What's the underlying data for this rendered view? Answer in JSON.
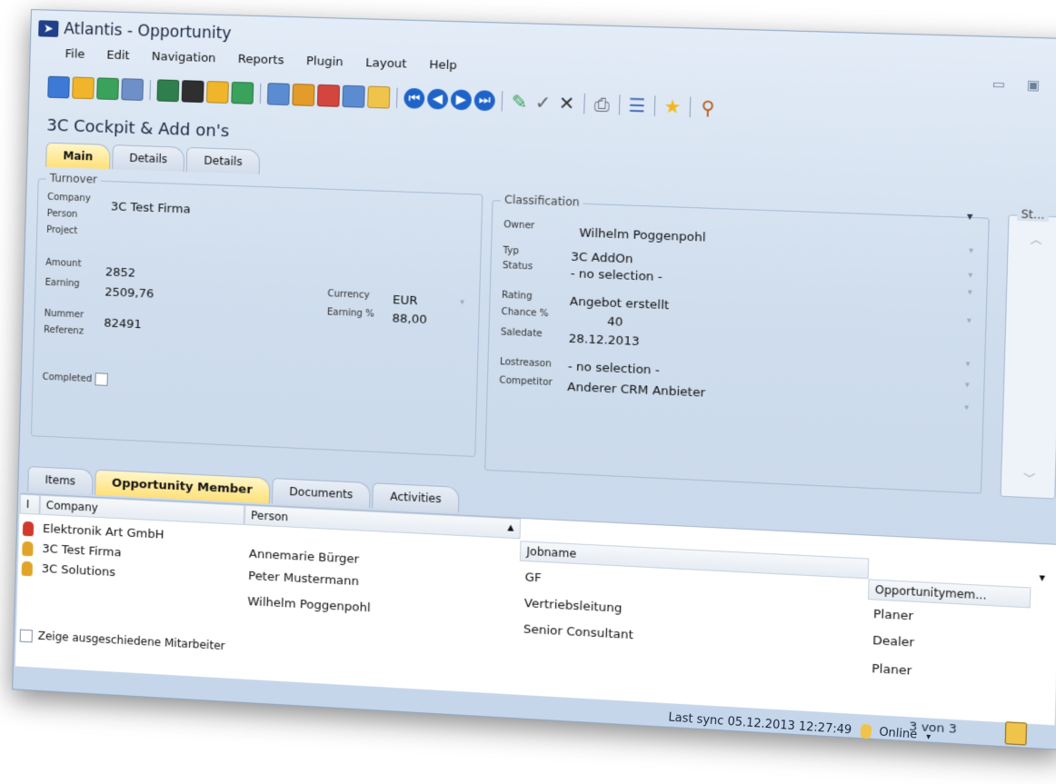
{
  "window": {
    "title": "Atlantis - Opportunity",
    "record_title": "3C Cockpit & Add on's",
    "controls": [
      "▭",
      "▣",
      "✕"
    ]
  },
  "menu": [
    "File",
    "Edit",
    "Navigation",
    "Reports",
    "Plugin",
    "Layout",
    "Help"
  ],
  "toolbar": {
    "groups": [
      [
        {
          "icon": "building-icon",
          "color": "#3d7ad6"
        },
        {
          "icon": "open-folder-icon",
          "color": "#f0b52a"
        },
        {
          "icon": "money-icon",
          "color": "#3aa25a"
        },
        {
          "icon": "calendar-icon",
          "color": "#6e8fc8"
        }
      ],
      [
        {
          "icon": "new-company-icon",
          "color": "#2e7f4b"
        },
        {
          "icon": "new-person-icon",
          "color": "#2f2f2f"
        },
        {
          "icon": "new-folder-icon",
          "color": "#f0b52a"
        },
        {
          "icon": "new-money-icon",
          "color": "#3aa25a"
        }
      ],
      [
        {
          "icon": "new-calendar-icon",
          "color": "#5b8cd1"
        },
        {
          "icon": "new-task-icon",
          "color": "#e39b2a"
        },
        {
          "icon": "new-phone-icon",
          "color": "#d2463d"
        },
        {
          "icon": "new-document-icon",
          "color": "#5b8cd1"
        },
        {
          "icon": "new-email-icon",
          "color": "#f0c34a"
        }
      ],
      [
        {
          "icon": "first-record-icon",
          "glyph": "⏮"
        },
        {
          "icon": "previous-record-icon",
          "glyph": "◀"
        },
        {
          "icon": "next-record-icon",
          "glyph": "▶"
        },
        {
          "icon": "last-record-icon",
          "glyph": "⏭"
        }
      ],
      [
        {
          "icon": "edit-pencil-icon",
          "glyph": "✎",
          "color": "#3aa25a"
        },
        {
          "icon": "save-check-icon",
          "glyph": "✓",
          "color": "#666"
        },
        {
          "icon": "cancel-x-icon",
          "glyph": "✕",
          "color": "#333"
        }
      ],
      [
        {
          "icon": "print-icon",
          "glyph": "⎙",
          "color": "#667"
        }
      ],
      [
        {
          "icon": "list-icon",
          "glyph": "☰",
          "color": "#4a6fb3"
        }
      ],
      [
        {
          "icon": "favorite-star-icon",
          "glyph": "★",
          "color": "#f2b71a"
        }
      ],
      [
        {
          "icon": "search-magnifier-icon",
          "glyph": "⚲",
          "color": "#b55a1c"
        }
      ]
    ]
  },
  "top_tabs": [
    "Main",
    "Details",
    "Details"
  ],
  "turnover": {
    "legend": "Turnover",
    "company_label": "Company",
    "company_value": "3C Test Firma",
    "person_label": "Person",
    "project_label": "Project",
    "amount_label": "Amount",
    "amount_value": "2852",
    "earning_label": "Earning",
    "earning_value": "2509,76",
    "currency_label": "Currency",
    "currency_value": "EUR",
    "earning_pct_label": "Earning %",
    "earning_pct_value": "88,00",
    "nummer_label": "Nummer",
    "nummer_value": "82491",
    "referenz_label": "Referenz",
    "completed_label": "Completed"
  },
  "classification": {
    "legend": "Classification",
    "owner_label": "Owner",
    "owner_value": "Wilhelm Poggenpohl",
    "typ_label": "Typ",
    "typ_value": "3C AddOn",
    "status_label": "Status",
    "status_value": "- no selection -",
    "rating_label": "Rating",
    "rating_value": "Angebot erstellt",
    "chance_label": "Chance %",
    "chance_value": "40",
    "saledate_label": "Saledate",
    "saledate_value": "28.12.2013",
    "lostreason_label": "Lostreason",
    "lostreason_value": "- no selection -",
    "competitor_label": "Competitor",
    "competitor_value": "Anderer CRM Anbieter"
  },
  "side_panel": {
    "legend": "St..."
  },
  "bottom_tabs": [
    "Items",
    "Opportunity Member",
    "Documents",
    "Activities"
  ],
  "grid": {
    "columns": [
      "I",
      "Company",
      "Person",
      "Jobname",
      "Opportunitymem..."
    ],
    "rows": [
      {
        "company": "Elektronik Art GmbH",
        "person": "Annemarie  Bürger",
        "jobname": "GF",
        "role": "Planer",
        "icon_color": "#d0392b"
      },
      {
        "company": "3C Test Firma",
        "person": "Peter  Mustermann",
        "jobname": "Vertriebsleitung",
        "role": "Dealer",
        "icon_color": "#e0a528"
      },
      {
        "company": "3C Solutions",
        "person": "Wilhelm  Poggenpohl",
        "jobname": "Senior Consultant",
        "role": "Planer",
        "icon_color": "#e0a528"
      }
    ],
    "show_former_label": "Zeige ausgeschiedene Mitarbeiter"
  },
  "status_bar": {
    "record_count": "3 von 3",
    "last_sync": "Last sync 05.12.2013 12:27:49",
    "connection": "Online"
  }
}
